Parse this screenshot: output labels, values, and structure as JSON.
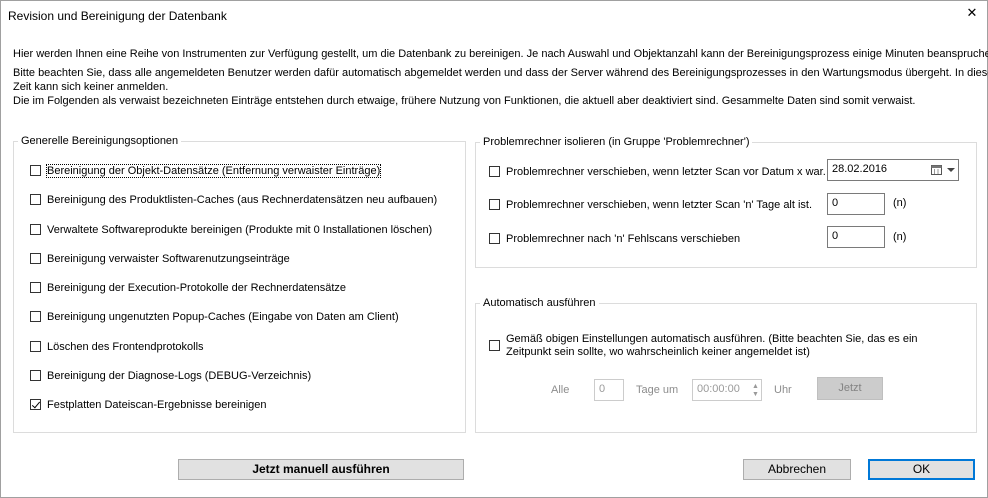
{
  "window": {
    "title": "Revision und Bereinigung der Datenbank",
    "close_glyph": "✕"
  },
  "intro": {
    "line1": "Hier werden Ihnen eine Reihe von Instrumenten zur Verfügung gestellt, um die Datenbank zu bereinigen. Je nach Auswahl und Objektanzahl kann der Bereinigungsprozess einige Minuten beanspruchen.",
    "line2": "Bitte beachten Sie, dass alle angemeldeten Benutzer werden dafür automatisch abgemeldet werden und dass der Server während des Bereinigungsprozesses in den Wartungsmodus übergeht. In dieser",
    "line3": "Zeit kann sich keiner anmelden.",
    "line4": "Die im Folgenden als verwaist bezeichneten Einträge entstehen durch etwaige, frühere Nutzung von Funktionen, die aktuell aber deaktiviert sind. Gesammelte Daten sind somit verwaist."
  },
  "general": {
    "legend": "Generelle Bereinigungsoptionen",
    "options": [
      {
        "label": "Bereinigung der Objekt-Datensätze (Entfernung verwaister Einträge)",
        "checked": false
      },
      {
        "label": "Bereinigung des Produktlisten-Caches (aus Rechnerdatensätzen neu aufbauen)",
        "checked": false
      },
      {
        "label": "Verwaltete Softwareprodukte bereinigen (Produkte mit 0 Installationen löschen)",
        "checked": false
      },
      {
        "label": "Bereinigung verwaister Softwarenutzungseinträge",
        "checked": false
      },
      {
        "label": "Bereinigung der Execution-Protokolle der Rechnerdatensätze",
        "checked": false
      },
      {
        "label": "Bereinigung ungenutzten Popup-Caches (Eingabe von Daten am Client)",
        "checked": false
      },
      {
        "label": "Löschen des Frontendprotokolls",
        "checked": false
      },
      {
        "label": "Bereinigung der Diagnose-Logs (DEBUG-Verzeichnis)",
        "checked": false
      },
      {
        "label": "Festplatten Dateiscan-Ergebnisse bereinigen",
        "checked": true
      }
    ]
  },
  "problem": {
    "legend": "Problemrechner isolieren (in Gruppe 'Problemrechner')",
    "by_date_label": "Problemrechner verschieben, wenn letzter Scan vor Datum x war.",
    "by_date_value": "28.02.2016",
    "by_days_label": "Problemrechner verschieben, wenn letzter Scan 'n' Tage alt ist.",
    "by_days_value": "0",
    "by_days_unit": "(n)",
    "by_fails_label": "Problemrechner nach 'n' Fehlscans verschieben",
    "by_fails_value": "0",
    "by_fails_unit": "(n)"
  },
  "auto": {
    "legend": "Automatisch ausführen",
    "label_line1": "Gemäß obigen Einstellungen automatisch ausführen. (Bitte beachten Sie, das es ein",
    "label_line2": "Zeitpunkt sein sollte, wo wahrscheinlich keiner angemeldet ist)",
    "every_label": "Alle",
    "days_value": "0",
    "days_label": "Tage um",
    "time_value": "00:00:00",
    "time_unit": "Uhr",
    "now_button": "Jetzt"
  },
  "footer": {
    "run_manual": "Jetzt manuell ausführen",
    "cancel": "Abbrechen",
    "ok": "OK"
  }
}
